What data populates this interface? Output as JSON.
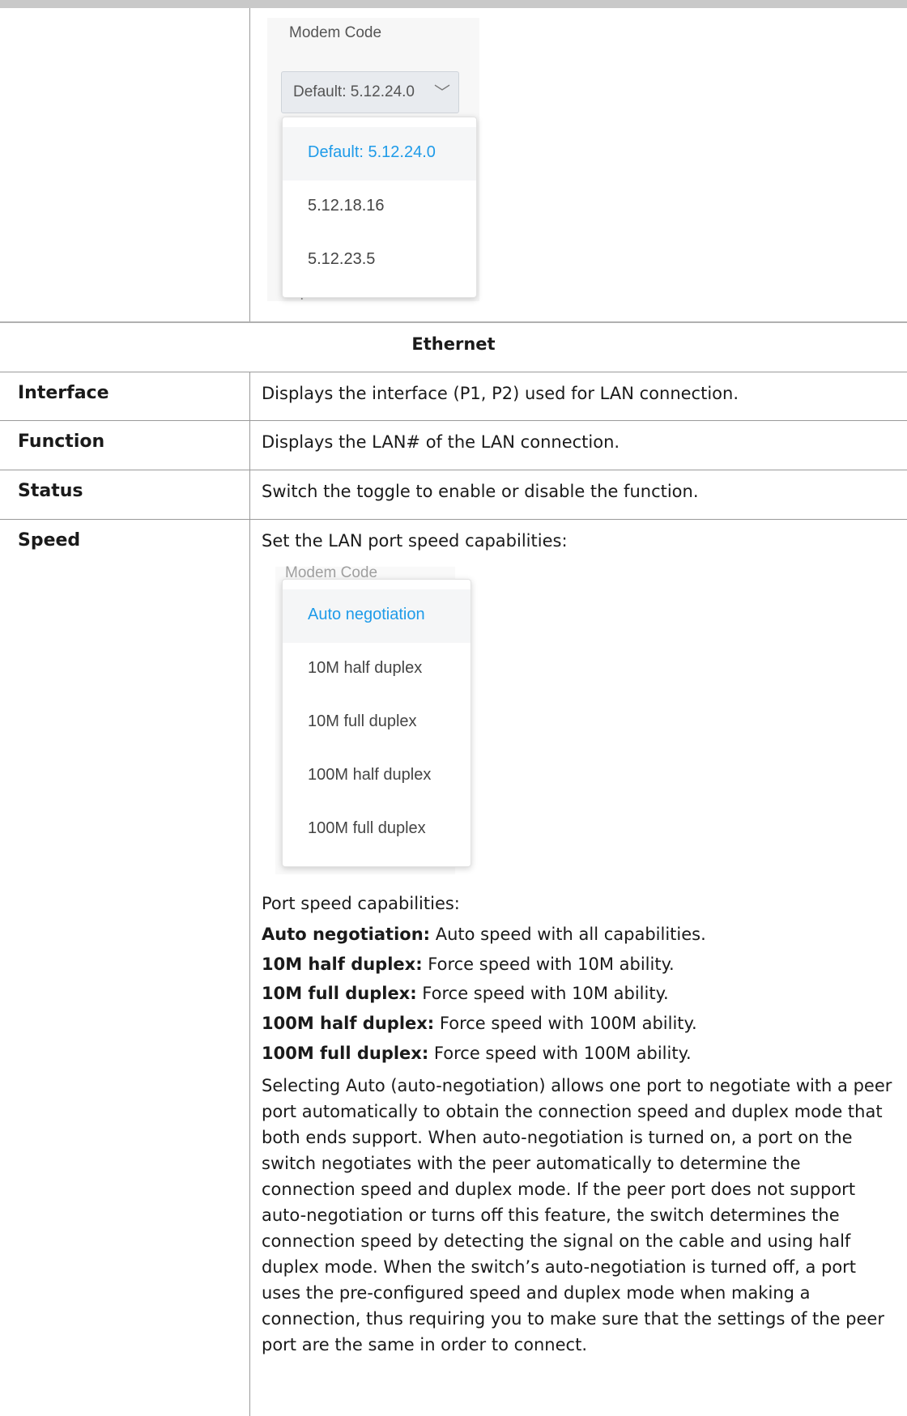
{
  "modem_panel": {
    "label": "Modem Code",
    "selected_value": "Default: 5.12.24.0",
    "options": [
      "Default: 5.12.24.0",
      "5.12.18.16",
      "5.12.23.5"
    ],
    "obscured_label": "Speed"
  },
  "section": {
    "title": "Ethernet"
  },
  "rows": [
    {
      "label": "Interface",
      "desc": "Displays the interface (P1, P2) used for LAN connection."
    },
    {
      "label": "Function",
      "desc": "Displays the LAN# of the LAN connection."
    },
    {
      "label": "Status",
      "desc": "Switch the toggle to enable or disable the function."
    },
    {
      "label": "Speed",
      "desc": "Set the LAN port speed capabilities:"
    }
  ],
  "speed_panel": {
    "faded_label": "Modem Code",
    "options": [
      "Auto negotiation",
      "10M half duplex",
      "10M full duplex",
      "100M half duplex",
      "100M full duplex"
    ]
  },
  "capabilities": {
    "intro": "Port speed capabilities:",
    "items": [
      {
        "term": "Auto negotiation:",
        "text": " Auto speed with all capabilities."
      },
      {
        "term": "10M half duplex:",
        "text": " Force speed with 10M ability."
      },
      {
        "term": "10M full duplex:",
        "text": " Force speed with 10M ability."
      },
      {
        "term": "100M half duplex:",
        "text": " Force speed with 100M ability."
      },
      {
        "term": "100M full duplex:",
        "text": " Force speed with 100M ability."
      }
    ],
    "paragraph": "Selecting Auto (auto-negotiation) allows one port to negotiate with a peer port automatically to obtain the connection speed and duplex mode that both ends support. When auto-negotiation is turned on, a port on the switch negotiates with the peer automatically to determine the connection speed and duplex mode. If the peer port does not support auto-negotiation or turns off this feature, the switch determines the connection speed by detecting the signal on the cable and using half duplex mode. When the switch’s auto-negotiation is turned off, a port uses the pre-configured speed and duplex mode when making a connection, thus requiring you to make sure that the settings of the peer port are the same in order to connect."
  },
  "colors": {
    "selected_option": "#1e9be9",
    "rule": "#9a9a9a"
  }
}
